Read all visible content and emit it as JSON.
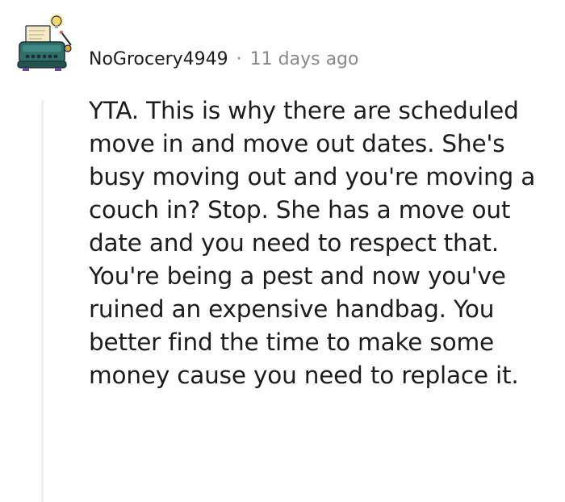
{
  "comment": {
    "author": "NoGrocery4949",
    "separator": "·",
    "timestamp": "11 days ago",
    "body": "YTA. This is why there are scheduled move in and move out dates. She's busy moving out and you're moving a couch in? Stop. She has a move out date and you need to respect that. You're being a pest and now you've ruined an expensive handbag. You better find the time to make some money cause you need to replace it."
  },
  "avatar": {
    "icon": "typewriter-snoo-avatar-icon",
    "colors": {
      "body": "#2f6f6a",
      "paper": "#f3e9c6",
      "bulb": "#f5d76e",
      "outline": "#1f2a33"
    }
  },
  "colors": {
    "text": "#1c1c1c",
    "meta": "#878a8c",
    "thread_line": "#edeff1"
  }
}
